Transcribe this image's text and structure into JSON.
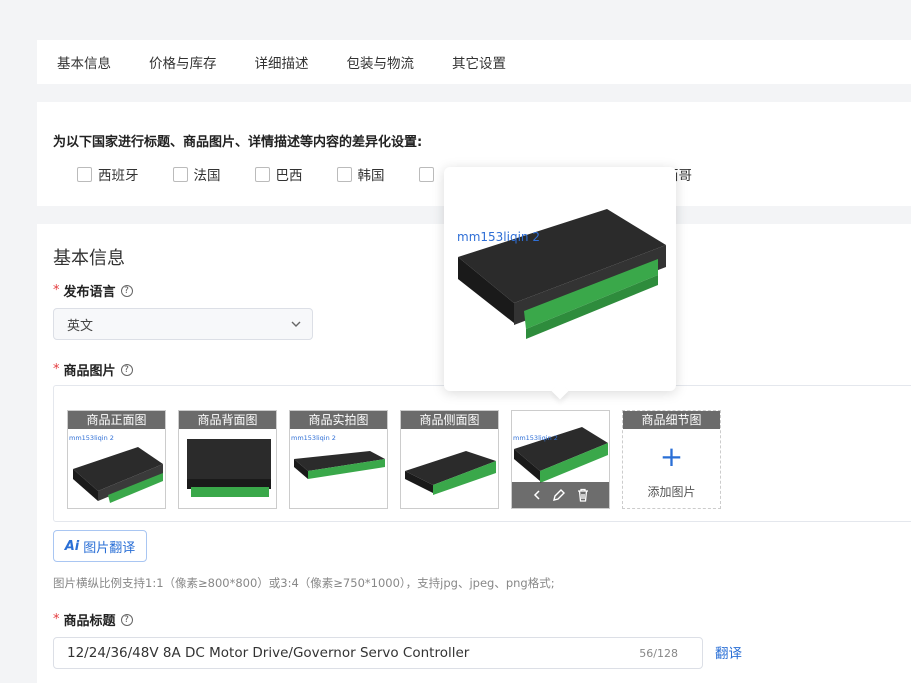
{
  "tabs": [
    "基本信息",
    "价格与库存",
    "详细描述",
    "包装与物流",
    "其它设置"
  ],
  "countries": {
    "title": "为以下国家进行标题、商品图片、详情描述等内容的差异化设置:",
    "items": [
      "西班牙",
      "法国",
      "巴西",
      "韩国",
      "墨西哥"
    ]
  },
  "basic": {
    "section_title": "基本信息",
    "lang_label": "发布语言",
    "lang_value": "英文",
    "images_label": "商品图片",
    "thumbs": [
      "商品正面图",
      "商品背面图",
      "商品实拍图",
      "商品侧面图"
    ],
    "add_label": "商品细节图",
    "add_text": "添加图片",
    "watermark": "mm153liqin 2",
    "ai_prefix": "Ai",
    "ai_label": "图片翻译",
    "hint": "图片横纵比例支持1:1（像素≥800*800）或3:4（像素≥750*1000），支持jpg、jpeg、png格式;",
    "title_label": "商品标题",
    "title_value": "12/24/36/48V 8A DC Motor Drive/Governor Servo Controller",
    "title_count": "56/128",
    "translate": "翻译"
  },
  "colors": {
    "accent": "#2a6fd6",
    "required": "#e4393c",
    "caption_bg": "#6b6b6b"
  }
}
